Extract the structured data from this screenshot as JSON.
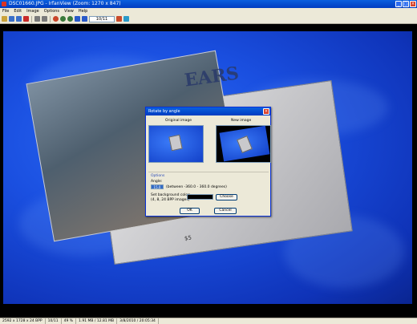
{
  "window": {
    "title": "DSC01660.JPG - IrfanView (Zoom: 1270 x 847)",
    "min_glyph": "_",
    "max_glyph": "□",
    "close_glyph": "×"
  },
  "menu": [
    "File",
    "Edit",
    "Image",
    "Options",
    "View",
    "Help"
  ],
  "toolbar": {
    "page_value": "10/11",
    "icons": [
      {
        "name": "open-icon",
        "color": "#c9a23a"
      },
      {
        "name": "slideshow-icon",
        "color": "#3a6fc9"
      },
      {
        "name": "save-icon",
        "color": "#3a6fc9"
      },
      {
        "name": "delete-icon",
        "color": "#c92a2a"
      },
      {
        "name": "copy-icon",
        "color": "#7a7a7a"
      },
      {
        "name": "paste-icon",
        "color": "#7a7a7a"
      },
      {
        "name": "info-icon",
        "color": "#c9452a"
      },
      {
        "name": "zoom-in-icon",
        "color": "#3a7a3a"
      },
      {
        "name": "zoom-out-icon",
        "color": "#3a7a3a"
      },
      {
        "name": "back-icon",
        "color": "#2a5ac9"
      },
      {
        "name": "forward-icon",
        "color": "#2a5ac9"
      }
    ]
  },
  "image": {
    "cover_text": "EARS",
    "price_text": "$5"
  },
  "dialog": {
    "title": "Rotate by angle",
    "close_glyph": "×",
    "original_label": "Original image",
    "new_label": "New image",
    "options_label": "Options",
    "angle_label": "Angle:",
    "angle_value": "15.0",
    "angle_hint": "(between -360.0 - 360.0 degrees)",
    "bg_label": "Set background color:",
    "bg_hint": "(4, 8, 24 BPP images)",
    "bg_color": "#000000",
    "choose_label": "Choose",
    "ok_label": "OK",
    "cancel_label": "Cancel"
  },
  "status": {
    "dims": "2592 x 1728 x 24 BPP",
    "index": "10/11",
    "zoom": "49 %",
    "size": "1.91 MB / 12.81 MB",
    "date": "3/8/2010 / 20:05:34"
  }
}
